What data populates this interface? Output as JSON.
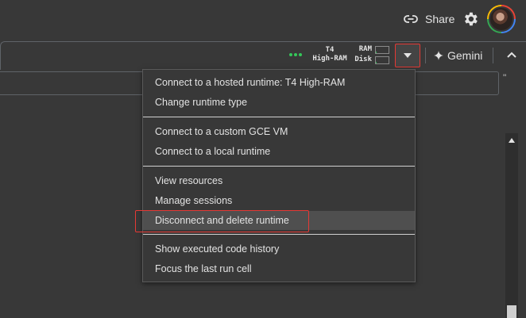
{
  "header": {
    "share_label": "Share",
    "share_icon": "link-icon",
    "settings_icon": "gear-icon",
    "avatar_icon": "user-avatar"
  },
  "runtime": {
    "status_icon": "connected-dots",
    "status_color": "#34c759",
    "gpu_line1": "T4",
    "gpu_line2": "High-RAM",
    "ram_label": "RAM",
    "disk_label": "Disk",
    "ram_fraction": 0.05,
    "disk_fraction": 0.05,
    "dropdown_icon": "caret-down-icon"
  },
  "gemini": {
    "label": "Gemini",
    "icon": "sparkle-icon"
  },
  "cell": {
    "trailing_quote": "\""
  },
  "menu": {
    "groups": [
      [
        "Connect to a hosted runtime: T4 High-RAM",
        "Change runtime type"
      ],
      [
        "Connect to a custom GCE VM",
        "Connect to a local runtime"
      ],
      [
        "View resources",
        "Manage sessions",
        "Disconnect and delete runtime"
      ],
      [
        "Show executed code history",
        "Focus the last run cell"
      ]
    ],
    "highlighted_item": "Disconnect and delete runtime"
  },
  "accent": {
    "annotation_red": "#e53935",
    "meter_green": "#34a853"
  }
}
